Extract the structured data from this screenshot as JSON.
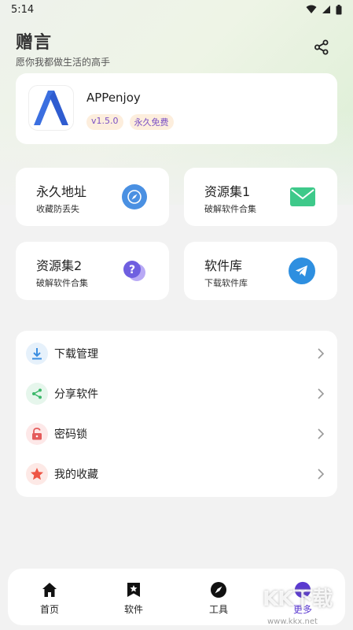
{
  "status_bar": {
    "time": "5:14"
  },
  "header": {
    "title": "赠言",
    "subtitle": "愿你我都做生活的高手"
  },
  "app_card": {
    "name": "APPenjoy",
    "badges": [
      "v1.5.0",
      "永久免费"
    ]
  },
  "tiles": [
    {
      "title": "永久地址",
      "subtitle": "收藏防丢失",
      "icon": "compass-icon",
      "color": "#4a90e2"
    },
    {
      "title": "资源集1",
      "subtitle": "破解软件合集",
      "icon": "mail-icon",
      "color": "#3ec98a"
    },
    {
      "title": "资源集2",
      "subtitle": "破解软件合集",
      "icon": "help-chat-icon",
      "color": "#7b6fe6"
    },
    {
      "title": "软件库",
      "subtitle": "下载软件库",
      "icon": "telegram-icon",
      "color": "#2e8fe0"
    }
  ],
  "menu": [
    {
      "label": "下载管理",
      "icon": "download-icon"
    },
    {
      "label": "分享软件",
      "icon": "share-icon"
    },
    {
      "label": "密码锁",
      "icon": "lock-icon"
    },
    {
      "label": "我的收藏",
      "icon": "star-icon"
    }
  ],
  "bottom_nav": [
    {
      "label": "首页",
      "icon": "home-icon"
    },
    {
      "label": "软件",
      "icon": "bookmark-star-icon"
    },
    {
      "label": "工具",
      "icon": "compass-icon"
    },
    {
      "label": "更多",
      "icon": "smile-icon",
      "active": true
    }
  ],
  "watermark": {
    "text": "KK下载",
    "url": "www.kkx.net"
  }
}
